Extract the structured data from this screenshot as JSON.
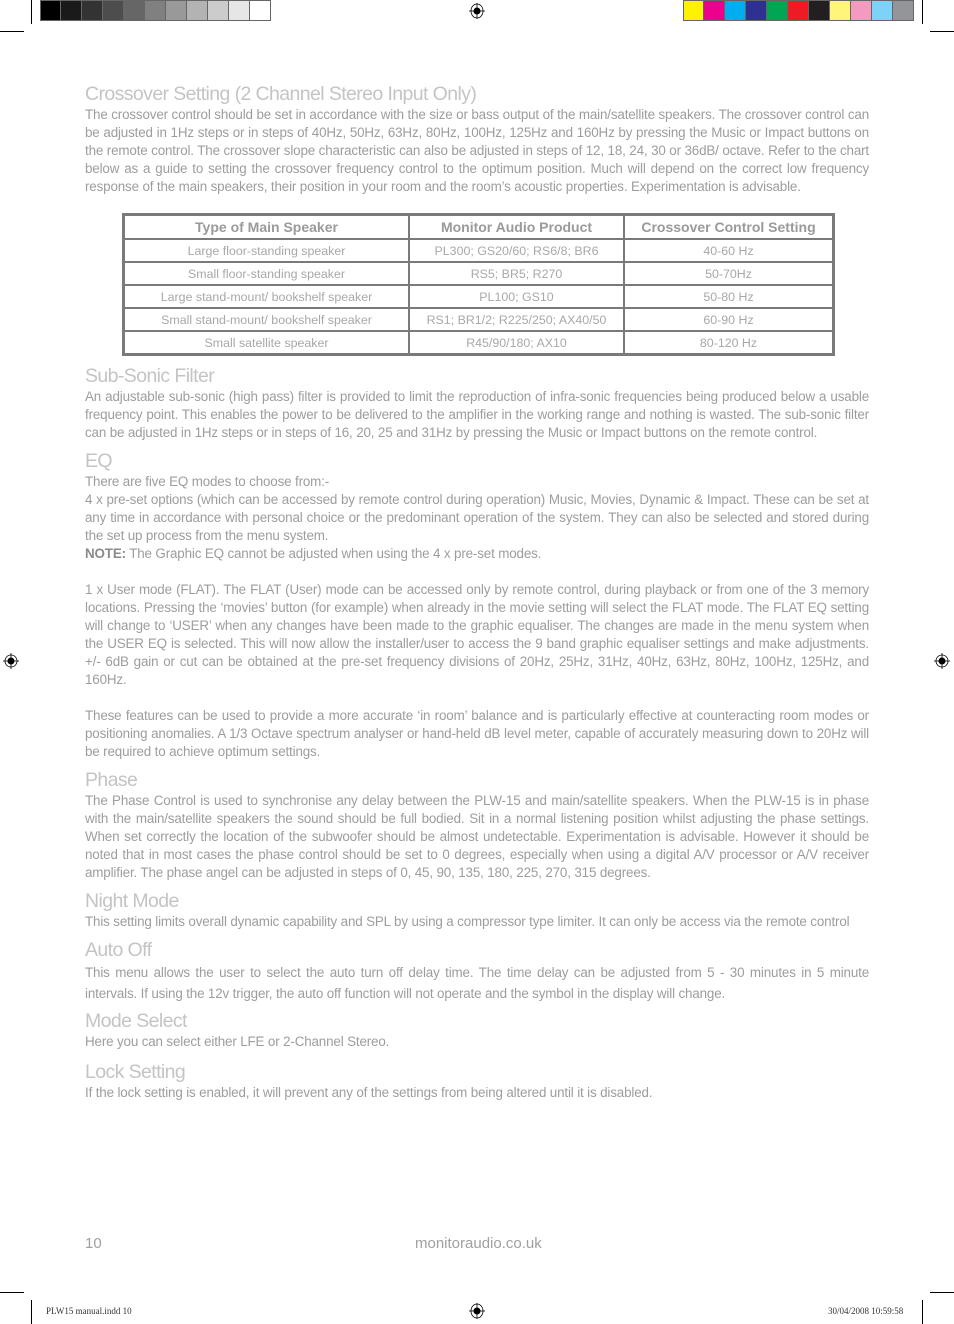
{
  "print_marks": {
    "grayscale_swatches": [
      "#000000",
      "#1a1a1a",
      "#333333",
      "#4d4d4d",
      "#666666",
      "#808080",
      "#999999",
      "#b3b3b3",
      "#cccccc",
      "#e6e6e6",
      "#ffffff"
    ],
    "color_swatches": [
      "#fff200",
      "#ec008c",
      "#00aeef",
      "#2e3192",
      "#00a651",
      "#ed1c24",
      "#231f20",
      "#fff57a",
      "#f49ac1",
      "#7dd3f7",
      "#939598"
    ],
    "slug_left": "PLW15 manual.indd   10",
    "slug_right": "30/04/2008   10:59:58"
  },
  "sections": {
    "crossover": {
      "heading": "Crossover Setting (2 Channel Stereo Input Only)",
      "body": "The crossover control should be set in accordance with the size or bass output of the main/satellite speakers. The crossover control can be adjusted in 1Hz steps or in steps of 40Hz, 50Hz, 63Hz, 80Hz, 100Hz, 125Hz and 160Hz by pressing the Music or Impact buttons on the remote control. The crossover slope characteristic can also be adjusted in steps of 12, 18, 24, 30 or 36dB/ octave. Refer to the chart below as a guide to setting the crossover frequency control to the optimum position. Much will depend on the correct low frequency response of the main speakers, their position in your room and the room’s acoustic properties. Experimentation is advisable."
    },
    "table": {
      "headers": [
        "Type of Main Speaker",
        "Monitor Audio Product",
        "Crossover Control Setting"
      ],
      "rows": [
        [
          "Large floor-standing speaker",
          "PL300; GS20/60; RS6/8; BR6",
          "40-60 Hz"
        ],
        [
          "Small floor-standing speaker",
          "RS5; BR5; R270",
          "50-70Hz"
        ],
        [
          "Large stand-mount/ bookshelf speaker",
          "PL100; GS10",
          "50-80 Hz"
        ],
        [
          "Small stand-mount/ bookshelf speaker",
          "RS1; BR1/2; R225/250; AX40/50",
          "60-90 Hz"
        ],
        [
          "Small satellite speaker",
          "R45/90/180; AX10",
          "80-120 Hz"
        ]
      ]
    },
    "subsonic": {
      "heading": "Sub-Sonic Filter",
      "body": "An adjustable sub-sonic (high pass) filter is provided to limit the reproduction of infra-sonic frequencies being produced below a usable frequency point. This enables the power to be delivered to the amplifier in the working range and nothing is wasted.  The sub-sonic filter can be adjusted in 1Hz steps or in steps of 16, 20, 25 and 31Hz by pressing the Music or Impact buttons on the remote control."
    },
    "eq": {
      "heading": "EQ",
      "intro": "There are five EQ modes to choose from:-",
      "preset": "4 x pre-set options (which can be accessed by remote control during operation) Music, Movies, Dynamic & Impact. These can be set at any time in accordance with personal choice or the predominant operation of the system.  They can also be selected and stored during the set up process from the menu system.",
      "note_label": "NOTE:",
      "note_text": " The Graphic EQ cannot be adjusted when using the 4 x pre-set modes.",
      "user_mode": "1 x User mode (FLAT). The FLAT (User) mode can be accessed only by remote control, during playback or from one of the 3 memory locations. Pressing the ‘movies’ button (for example) when already in the movie setting will select the FLAT mode. The FLAT EQ setting will change to ‘USER’ when any changes have been made to the graphic equaliser.  The changes are made in the menu system when the USER EQ is selected.  This will now allow the installer/user to access the 9 band graphic equaliser settings and make adjustments. +/- 6dB gain or cut can be obtained at the pre-set frequency divisions of 20Hz, 25Hz, 31Hz, 40Hz, 63Hz, 80Hz, 100Hz, 125Hz, and 160Hz.",
      "features": "These features can be used to provide a more accurate ‘in room’ balance and is particularly effective at counteracting room modes or positioning anomalies. A 1/3 Octave spectrum analyser or hand-held dB level meter, capable of accurately measuring down to 20Hz will be required to achieve optimum settings."
    },
    "phase": {
      "heading": "Phase",
      "body": "The Phase Control is used to synchronise any delay between the PLW-15 and main/satellite speakers. When the PLW-15 is in phase with the main/satellite speakers the sound should be full bodied. Sit in a normal listening position whilst adjusting the phase settings. When set correctly the location of the subwoofer should be almost undetectable. Experimentation is advisable. However it should be noted that in most cases the phase control should be set to 0 degrees, especially when using a digital A/V processor or A/V receiver amplifier.  The phase angel can be adjusted in steps of 0, 45, 90, 135, 180, 225, 270, 315 degrees."
    },
    "night": {
      "heading": "Night Mode",
      "body": "This setting limits overall dynamic capability and SPL by using a compressor type limiter.  It can only be access via the remote control"
    },
    "autooff": {
      "heading": "Auto Off",
      "body": "This menu allows the user to select the auto turn off delay time. The time delay can be adjusted from 5 - 30 minutes in 5 minute intervals.  If using the 12v trigger, the auto off function will not operate and the symbol in the display will change."
    },
    "mode": {
      "heading": "Mode Select",
      "body": "Here you can select either LFE or 2-Channel Stereo."
    },
    "lock": {
      "heading": "Lock Setting",
      "body": "If the lock setting is enabled, it will prevent any of the settings from being altered until it is disabled."
    }
  },
  "footer": {
    "page_number": "10",
    "website": "monitoraudio.co.uk"
  }
}
